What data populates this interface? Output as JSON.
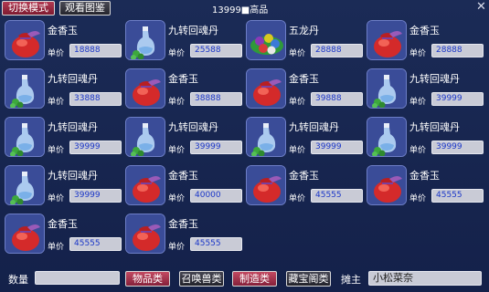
{
  "window": {
    "title": "13999■高品",
    "switch_mode_label": "切换模式",
    "view_catalog_label": "观看图鉴",
    "close_glyph": "✕"
  },
  "price_label": "单价",
  "items": [
    {
      "name": "金香玉",
      "price": "18888",
      "icon": "red-pouch-icon"
    },
    {
      "name": "九转回魂丹",
      "price": "25588",
      "icon": "potion-bottle-icon"
    },
    {
      "name": "五龙丹",
      "price": "28888",
      "icon": "dragon-pill-icon"
    },
    {
      "name": "金香玉",
      "price": "28888",
      "icon": "red-pouch-icon"
    },
    {
      "name": "九转回魂丹",
      "price": "33888",
      "icon": "potion-bottle-icon"
    },
    {
      "name": "金香玉",
      "price": "38888",
      "icon": "red-pouch-icon"
    },
    {
      "name": "金香玉",
      "price": "39888",
      "icon": "red-pouch-icon"
    },
    {
      "name": "九转回魂丹",
      "price": "39999",
      "icon": "potion-bottle-icon"
    },
    {
      "name": "九转回魂丹",
      "price": "39999",
      "icon": "potion-bottle-icon"
    },
    {
      "name": "九转回魂丹",
      "price": "39999",
      "icon": "potion-bottle-icon"
    },
    {
      "name": "九转回魂丹",
      "price": "39999",
      "icon": "potion-bottle-icon"
    },
    {
      "name": "九转回魂丹",
      "price": "39999",
      "icon": "potion-bottle-icon"
    },
    {
      "name": "九转回魂丹",
      "price": "39999",
      "icon": "potion-bottle-icon"
    },
    {
      "name": "金香玉",
      "price": "40000",
      "icon": "red-pouch-icon"
    },
    {
      "name": "金香玉",
      "price": "45555",
      "icon": "red-pouch-icon"
    },
    {
      "name": "金香玉",
      "price": "45555",
      "icon": "red-pouch-icon"
    },
    {
      "name": "金香玉",
      "price": "45555",
      "icon": "red-pouch-icon"
    },
    {
      "name": "金香玉",
      "price": "45555",
      "icon": "red-pouch-icon"
    }
  ],
  "bottom": {
    "quantity_label": "数量",
    "quantity_value": "",
    "categories": [
      "物品类",
      "召唤兽类",
      "制造类",
      "藏宝阁类"
    ],
    "active_categories": [
      0,
      2
    ],
    "owner_label": "摊主",
    "owner_name": "小松菜奈"
  },
  "colors": {
    "background": "#16254b",
    "active_button": "#b23a52",
    "price_text": "#1a36c8"
  }
}
